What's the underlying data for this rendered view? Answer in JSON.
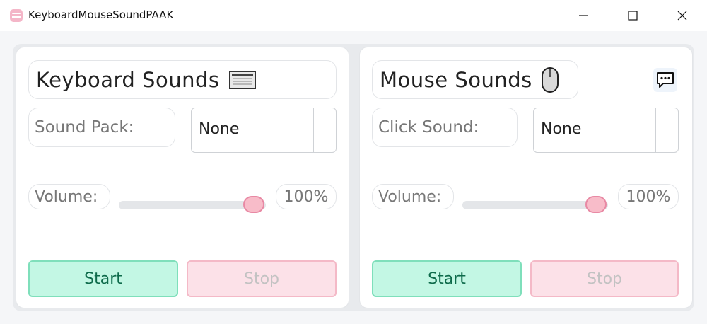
{
  "window": {
    "title": "KeyboardMouseSoundPAAK",
    "icon": "app-keyboard-icon",
    "controls": [
      "minimize-icon",
      "maximize-icon",
      "close-icon"
    ]
  },
  "keyboard": {
    "heading": "Keyboard Sounds",
    "heading_icon": "keyboard-icon",
    "pack_label": "Sound Pack:",
    "pack_value": "None",
    "volume_label": "Volume:",
    "volume_value": "100%",
    "volume_level": 100,
    "start_label": "Start",
    "stop_label": "Stop"
  },
  "mouse": {
    "heading": "Mouse Sounds",
    "heading_icon": "mouse-icon",
    "click_label": "Click Sound:",
    "click_value": "None",
    "volume_label": "Volume:",
    "volume_value": "100%",
    "volume_level": 100,
    "start_label": "Start",
    "stop_label": "Stop",
    "feedback_icon": "chat-bubble-icon"
  },
  "colors": {
    "accent_pink": "#f8bcc9",
    "start_green": "#c3f7e4",
    "start_text": "#0e6b4b",
    "stop_pink": "#fce1e8"
  }
}
